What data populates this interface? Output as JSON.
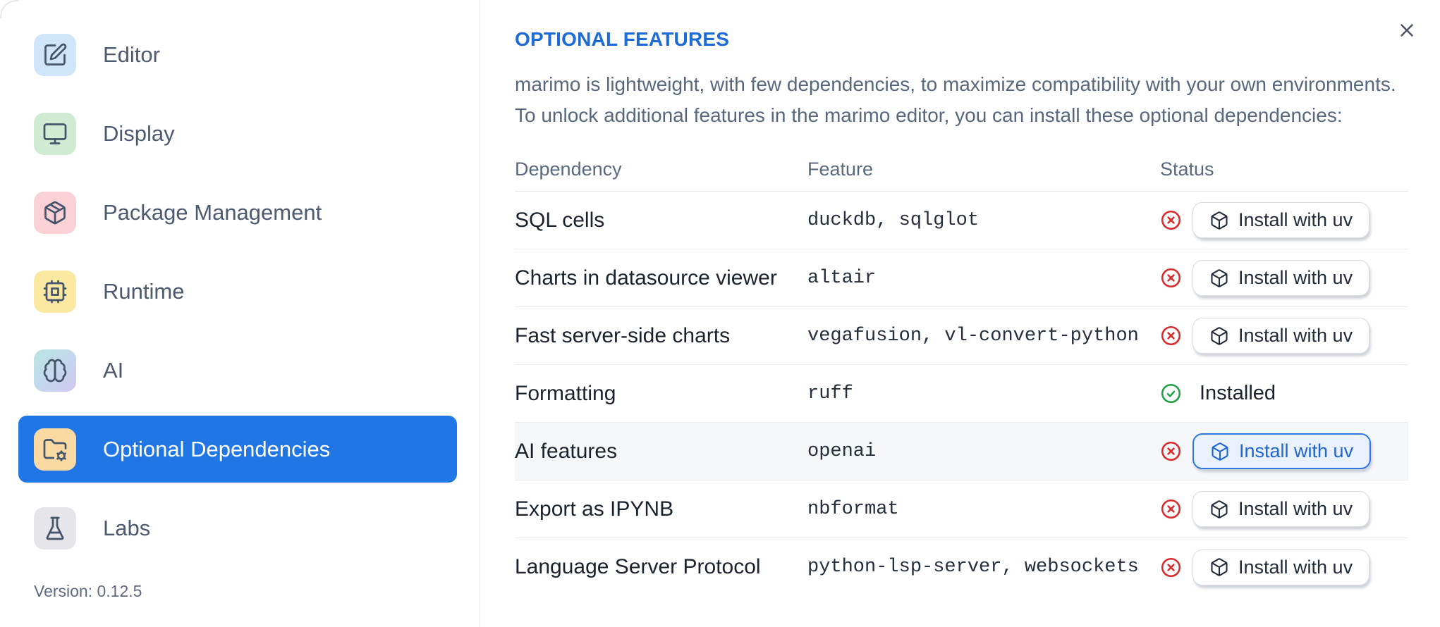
{
  "sidebar": {
    "items": [
      {
        "label": "Editor",
        "icon": "edit"
      },
      {
        "label": "Display",
        "icon": "monitor"
      },
      {
        "label": "Package Management",
        "icon": "package"
      },
      {
        "label": "Runtime",
        "icon": "cpu"
      },
      {
        "label": "AI",
        "icon": "brain"
      },
      {
        "label": "Optional Dependencies",
        "icon": "folder-cog",
        "selected": true
      },
      {
        "label": "Labs",
        "icon": "flask"
      }
    ],
    "version": "Version: 0.12.5"
  },
  "content": {
    "title": "OPTIONAL FEATURES",
    "description_lines": [
      "marimo is lightweight, with few dependencies, to maximize compatibility with your own environments.",
      "To unlock additional features in the marimo editor, you can install these optional dependencies:"
    ],
    "table": {
      "headers": [
        "Dependency",
        "Feature",
        "Status"
      ],
      "rows": [
        {
          "dependency": "SQL cells",
          "feature": "duckdb, sqlglot",
          "status": "missing",
          "action_label": "Install with uv"
        },
        {
          "dependency": "Charts in datasource viewer",
          "feature": "altair",
          "status": "missing",
          "action_label": "Install with uv"
        },
        {
          "dependency": "Fast server-side charts",
          "feature": "vegafusion, vl-convert-python",
          "status": "missing",
          "action_label": "Install with uv"
        },
        {
          "dependency": "Formatting",
          "feature": "ruff",
          "status": "installed",
          "status_label": "Installed"
        },
        {
          "dependency": "AI features",
          "feature": "openai",
          "status": "missing",
          "action_label": "Install with uv",
          "highlighted": true
        },
        {
          "dependency": "Export as IPYNB",
          "feature": "nbformat",
          "status": "missing",
          "action_label": "Install with uv"
        },
        {
          "dependency": "Language Server Protocol",
          "feature": "python-lsp-server, websockets",
          "status": "missing",
          "action_label": "Install with uv"
        }
      ]
    }
  },
  "colors": {
    "accent_blue": "#2176e6",
    "heading_blue": "#1c6bd8",
    "status_missing_red": "#d92b2b",
    "status_installed_green": "#22a049",
    "focused_button_bg": "#e9f1fd",
    "row_highlight_bg": "#f6f7f9"
  }
}
